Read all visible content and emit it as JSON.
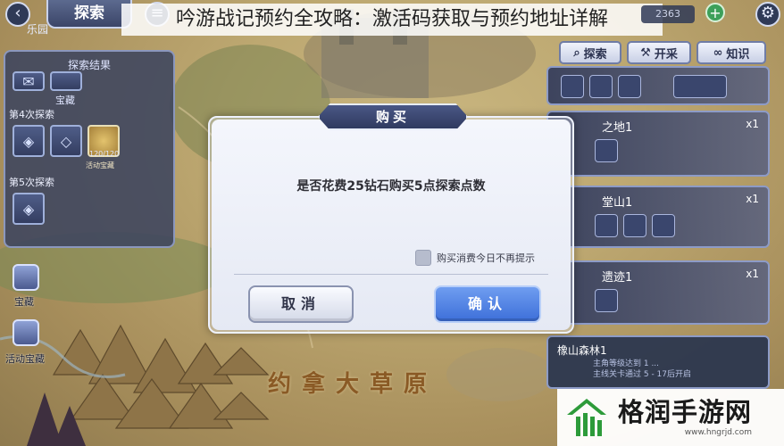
{
  "header": {
    "tab_label": "探索",
    "article_title": "吟游战记预约全攻略：激活码获取与预约地址详解",
    "subregion": "乐园",
    "counter": "2363",
    "plus": "+"
  },
  "left_panel": {
    "title": "探索结果",
    "chest_small_label": "宝藏",
    "section_4": "第4次探索",
    "section_5": "第5次探索",
    "chest_item_label": "120/120",
    "chest_item_caption": "活动宝藏"
  },
  "side_icons": [
    {
      "label": "宝藏"
    },
    {
      "label": "活动宝藏"
    }
  ],
  "right_panel": {
    "buttons": [
      {
        "label": "探索",
        "icon": "search-icon"
      },
      {
        "label": "开采",
        "icon": "pickaxe-icon"
      },
      {
        "label": "知识",
        "icon": "book-icon"
      }
    ],
    "cards": [
      {
        "name": "之地1",
        "count": "x1"
      },
      {
        "name": "堂山1",
        "count": "x1"
      },
      {
        "name": "遗迹1",
        "count": "x1"
      }
    ],
    "bottom_card": {
      "name": "橡山森林1",
      "line1": "主角等级达到 1 ...",
      "line2": "主线关卡通过 5 - 17后开启"
    }
  },
  "map": {
    "region_label": "约拿大草原"
  },
  "dialog": {
    "title": "购买",
    "message": "是否花费25钻石购买5点探索点数",
    "checkbox_label": "购买消费今日不再提示",
    "checkbox_checked": false,
    "cancel_label": "取消",
    "confirm_label": "确认"
  },
  "watermark": {
    "name": "格润手游网",
    "url": "www.hngrjd.com",
    "brand_color": "#2d9b3a"
  }
}
